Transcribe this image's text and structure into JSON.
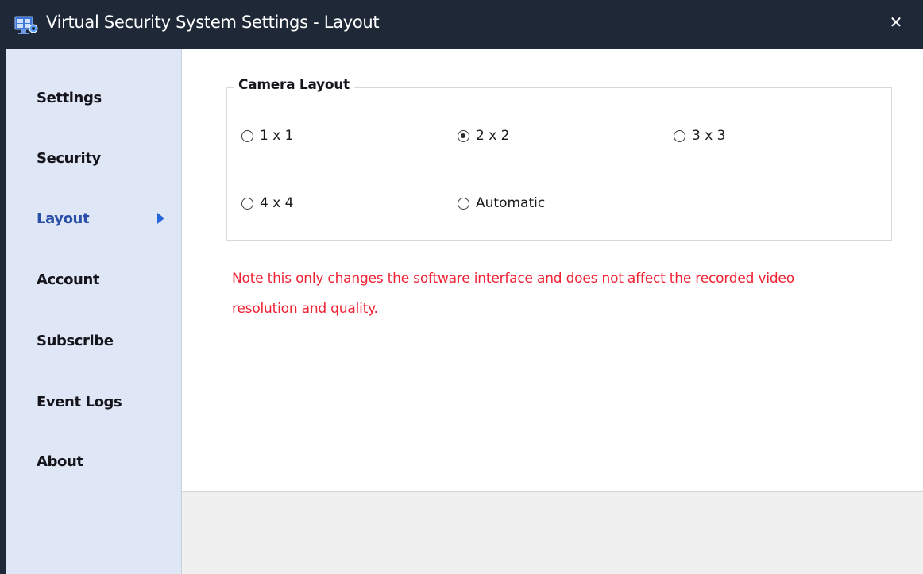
{
  "window": {
    "title": "Virtual Security System Settings - Layout",
    "close_label": "✕",
    "app_icon": "security-camera-app-icon"
  },
  "sidebar": {
    "items": [
      {
        "label": "Settings",
        "active": false
      },
      {
        "label": "Security",
        "active": false
      },
      {
        "label": "Layout",
        "active": true
      },
      {
        "label": "Account",
        "active": false
      },
      {
        "label": "Subscribe",
        "active": false
      },
      {
        "label": "Event Logs",
        "active": false
      },
      {
        "label": "About",
        "active": false
      }
    ],
    "active_color": "#2a4fa8",
    "arrow_color": "#2666d9"
  },
  "camera_layout": {
    "legend": "Camera Layout",
    "options": [
      {
        "label": "1 x 1",
        "checked": false
      },
      {
        "label": "2 x 2",
        "checked": true
      },
      {
        "label": "3 x 3",
        "checked": false
      },
      {
        "label": "4 x 4",
        "checked": false
      },
      {
        "label": "Automatic",
        "checked": false
      }
    ],
    "selected": "2 x 2"
  },
  "note": {
    "text": "Note this only changes the software interface and does not affect the recorded video resolution and quality.",
    "color": "#f02233"
  },
  "colors": {
    "titlebar": "#1e2836",
    "sidebar": "#dfe6f6",
    "content": "#ffffff",
    "footer": "#f0f0f0"
  }
}
